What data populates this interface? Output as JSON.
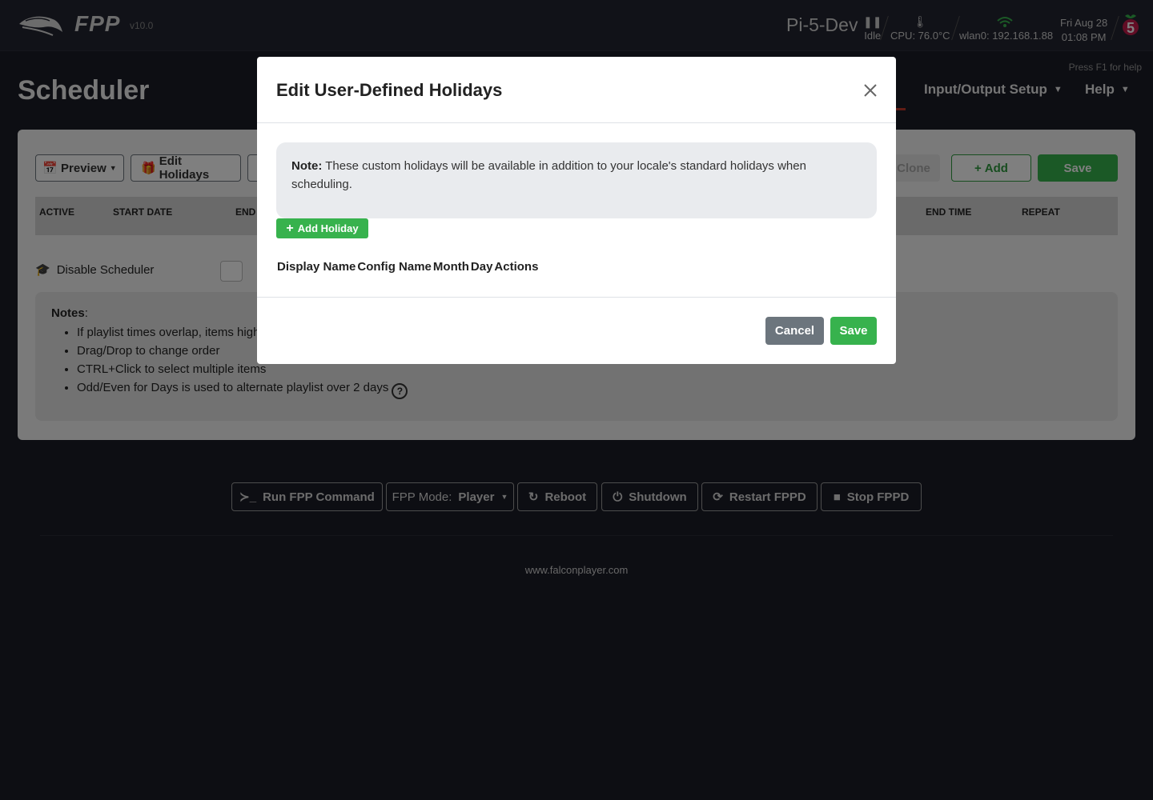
{
  "header": {
    "brand": "FPP",
    "version": "v10.0",
    "hostname": "Pi-5-Dev",
    "status": "Idle",
    "cpu": "CPU: 76.0°C",
    "network": "wlan0: 192.168.1.88",
    "date": "Fri Aug 28",
    "time": "01:08 PM"
  },
  "page": {
    "title": "Scheduler",
    "help_hint": "Press F1 for help",
    "nav": [
      "Input/Output Setup",
      "Help"
    ]
  },
  "toolbar": {
    "preview": "Preview",
    "edit_holidays": "Edit Holidays",
    "clone": "Clone",
    "add": "Add",
    "save": "Save"
  },
  "table": {
    "columns": [
      "ACTIVE",
      "START DATE",
      "END",
      "END TIME",
      "REPEAT"
    ]
  },
  "disable_scheduler": "Disable Scheduler",
  "notes": {
    "title": "Notes",
    "items": [
      "If playlist times overlap, items high",
      "Drag/Drop to change order",
      "CTRL+Click to select multiple items",
      "Odd/Even for Days is used to alternate playlist over 2 days"
    ]
  },
  "footer": {
    "run_command": "Run FPP Command",
    "mode_label": "FPP Mode:",
    "mode_value": "Player",
    "reboot": "Reboot",
    "shutdown": "Shutdown",
    "restart": "Restart FPPD",
    "stop": "Stop FPPD",
    "link": "www.falconplayer.com"
  },
  "modal": {
    "title": "Edit User-Defined Holidays",
    "note_label": "Note:",
    "note_text": "These custom holidays will be available in addition to your locale's standard holidays when scheduling.",
    "add_holiday": "Add Holiday",
    "columns": [
      "Display Name",
      "Config Name",
      "Month",
      "Day",
      "Actions"
    ],
    "cancel": "Cancel",
    "save": "Save"
  },
  "colors": {
    "accent_green": "#37b24d",
    "secondary_gray": "#6c757d",
    "dark_bg": "#1b1c27"
  }
}
